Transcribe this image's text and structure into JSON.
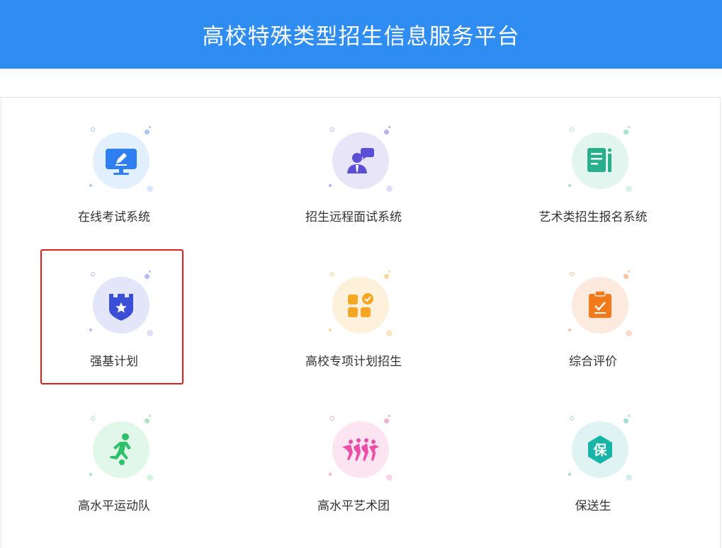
{
  "header": {
    "title": "高校特殊类型招生信息服务平台"
  },
  "tiles": [
    {
      "label": "在线考试系统",
      "icon": "computer-exam-icon",
      "accent": "#2f7ff0",
      "bg": "#e2effc",
      "dot": "#a9c8f2"
    },
    {
      "label": "招生远程面试系统",
      "icon": "remote-interview-icon",
      "accent": "#5b4fd6",
      "bg": "#e7e5f7",
      "dot": "#b9b2ea"
    },
    {
      "label": "艺术类招生报名系统",
      "icon": "art-registration-icon",
      "accent": "#27b08b",
      "bg": "#e2f5ee",
      "dot": "#a8e2cf"
    },
    {
      "label": "强基计划",
      "icon": "shield-star-icon",
      "accent": "#3a4fd6",
      "bg": "#e3e6f8",
      "dot": "#b3baee"
    },
    {
      "label": "高校专项计划招生",
      "icon": "app-grid-check-icon",
      "accent": "#f5a623",
      "bg": "#fdf1dc",
      "dot": "#f8d59a"
    },
    {
      "label": "综合评价",
      "icon": "clipboard-check-icon",
      "accent": "#f27a1a",
      "bg": "#fdeade",
      "dot": "#f7c3a0"
    },
    {
      "label": "高水平运动队",
      "icon": "soccer-player-icon",
      "accent": "#2ec16a",
      "bg": "#e1f7e9",
      "dot": "#a9e6c1"
    },
    {
      "label": "高水平艺术团",
      "icon": "dancers-icon",
      "accent": "#e94fa6",
      "bg": "#fde4f1",
      "dot": "#f4aed5"
    },
    {
      "label": "保送生",
      "icon": "baosong-hexagon-icon",
      "accent": "#18b4a8",
      "bg": "#def3f2",
      "dot": "#a2dcd8",
      "glyph": "保"
    }
  ]
}
